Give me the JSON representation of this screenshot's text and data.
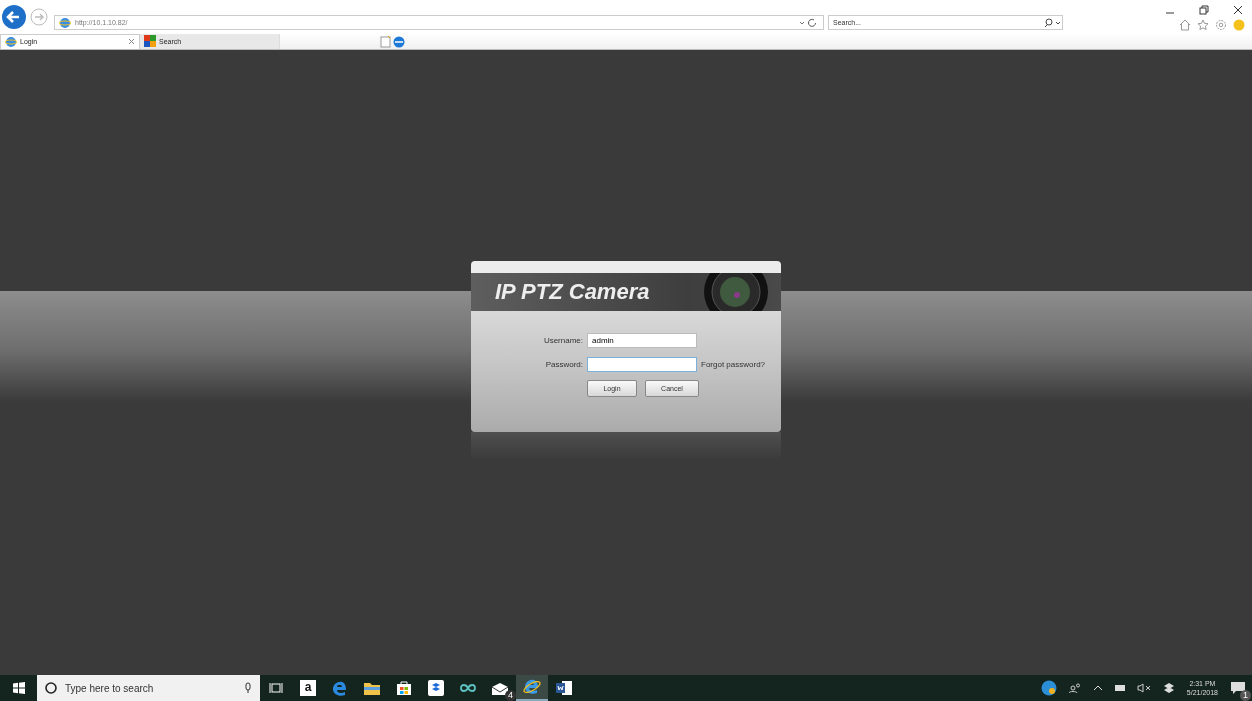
{
  "browser": {
    "address": "http://10.1.10.82/",
    "search_placeholder": "Search...",
    "tabs": [
      {
        "label": "Login",
        "selected": true
      },
      {
        "label": "Search",
        "selected": false
      }
    ]
  },
  "login": {
    "title": "IP PTZ Camera",
    "username_label": "Username:",
    "username": "admin",
    "password_label": "Password:",
    "forgot_link": "Forgot password?",
    "buttons": [
      "Login",
      "Cancel"
    ]
  },
  "taskbar": {
    "search_placeholder": "Type here to search",
    "apps": [
      {
        "kind": "taskview",
        "selected": false
      },
      {
        "kind": "amazon",
        "label": "a",
        "selected": false
      },
      {
        "kind": "edge",
        "selected": false
      },
      {
        "kind": "files",
        "selected": false
      },
      {
        "kind": "store",
        "selected": false
      },
      {
        "kind": "dropbox",
        "selected": false
      },
      {
        "kind": "infinity",
        "selected": false
      },
      {
        "kind": "mail",
        "badge": "4",
        "selected": false
      },
      {
        "kind": "ie",
        "selected": true
      },
      {
        "kind": "word",
        "selected": false
      }
    ],
    "time": "2:31 PM",
    "date": "5/21/2018",
    "notification_count": "1"
  }
}
